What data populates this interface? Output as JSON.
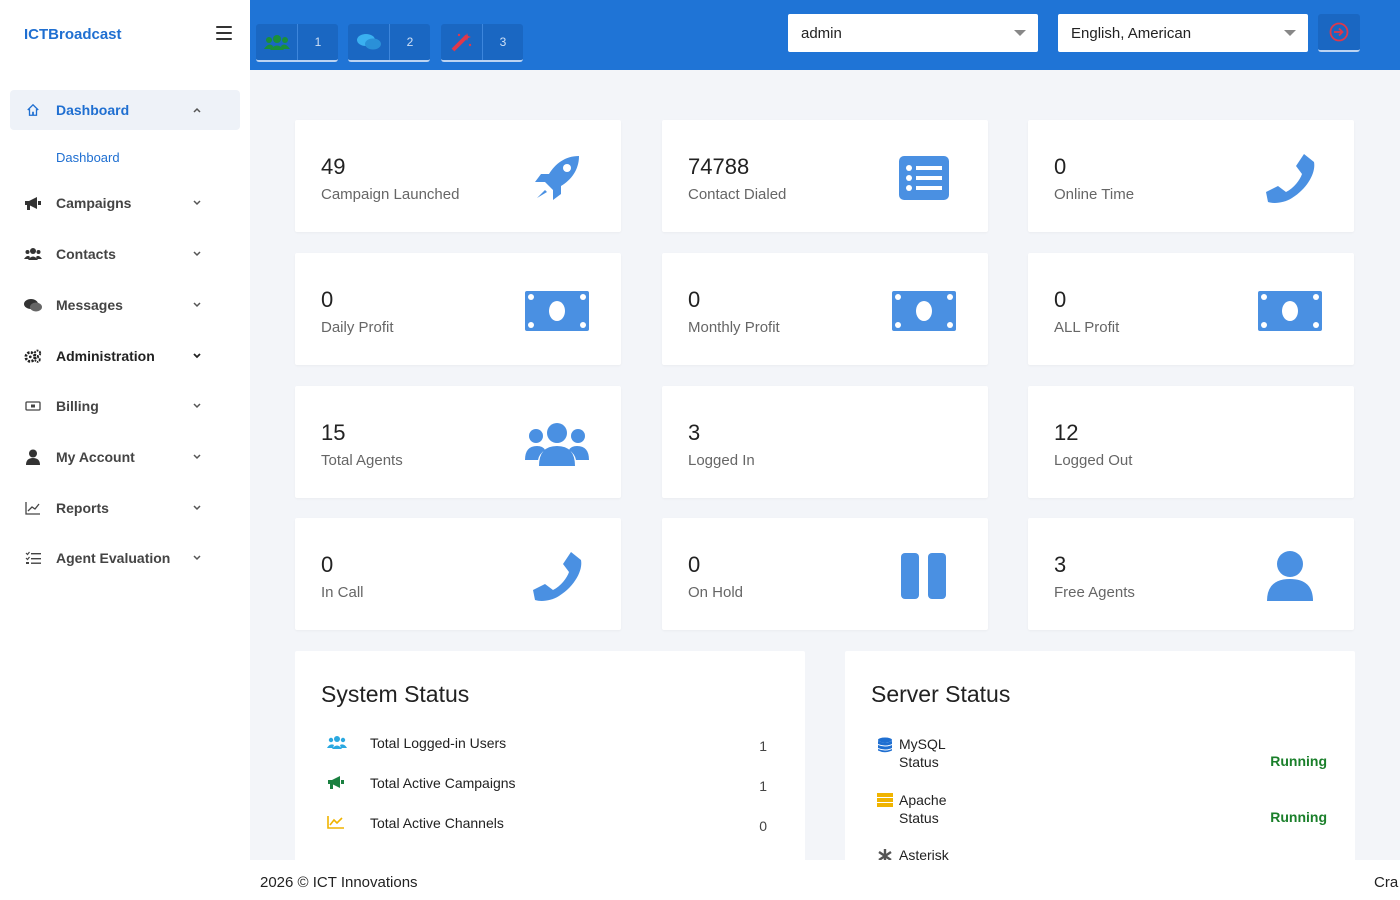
{
  "brand": "ICTBroadcast",
  "sidebar": {
    "items": [
      {
        "label": "Dashboard",
        "icon": "home-icon"
      },
      {
        "label": "Campaigns",
        "icon": "megaphone-icon"
      },
      {
        "label": "Contacts",
        "icon": "users-icon"
      },
      {
        "label": "Messages",
        "icon": "comments-icon"
      },
      {
        "label": "Administration",
        "icon": "cogs-icon"
      },
      {
        "label": "Billing",
        "icon": "money-icon"
      },
      {
        "label": "My Account",
        "icon": "user-icon"
      },
      {
        "label": "Reports",
        "icon": "chart-line-icon"
      },
      {
        "label": "Agent Evaluation",
        "icon": "list-check-icon"
      }
    ],
    "sub_item": "Dashboard"
  },
  "header": {
    "badges": [
      {
        "icon": "agents-icon",
        "count": "1"
      },
      {
        "icon": "comments-icon",
        "count": "2"
      },
      {
        "icon": "magic-wand-icon",
        "count": "3"
      }
    ],
    "user_select": "admin",
    "language_select": "English, American"
  },
  "cards": [
    {
      "value": "49",
      "label": "Campaign Launched",
      "icon": "rocket-icon"
    },
    {
      "value": "74788",
      "label": "Contact Dialed",
      "icon": "list-icon"
    },
    {
      "value": "0",
      "label": "Online Time",
      "icon": "phone-icon"
    },
    {
      "value": "0",
      "label": "Daily Profit",
      "icon": "money-bill-icon"
    },
    {
      "value": "0",
      "label": "Monthly Profit",
      "icon": "money-bill-icon"
    },
    {
      "value": "0",
      "label": "ALL Profit",
      "icon": "money-bill-icon"
    },
    {
      "value": "15",
      "label": "Total Agents",
      "icon": "users-icon"
    },
    {
      "value": "3",
      "label": "Logged In",
      "icon": ""
    },
    {
      "value": "12",
      "label": "Logged Out",
      "icon": ""
    },
    {
      "value": "0",
      "label": "In Call",
      "icon": "phone-icon"
    },
    {
      "value": "0",
      "label": "On Hold",
      "icon": "pause-icon"
    },
    {
      "value": "3",
      "label": "Free Agents",
      "icon": "user-icon"
    }
  ],
  "system_status": {
    "title": "System Status",
    "rows": [
      {
        "label": "Total Logged-in Users",
        "value": "1",
        "icon": "users-icon"
      },
      {
        "label": "Total Active Campaigns",
        "value": "1",
        "icon": "megaphone-icon"
      },
      {
        "label": "Total Active Channels",
        "value": "0",
        "icon": "chart-icon"
      }
    ]
  },
  "server_status": {
    "title": "Server Status",
    "rows": [
      {
        "line1": "MySQL",
        "line2": "Status",
        "status": "Running",
        "icon": "database-icon"
      },
      {
        "line1": "Apache",
        "line2": "Status",
        "status": "Running",
        "icon": "server-icon"
      },
      {
        "line1": "Asterisk",
        "line2": "",
        "status": "",
        "icon": "asterisk-icon"
      }
    ]
  },
  "footer": {
    "copyright": "2026 © ICT Innovations",
    "right_text": "Cra"
  },
  "colors": {
    "primary": "#1f74d6",
    "icon_blue": "#4a90e2",
    "running_green": "#1a7f2a"
  }
}
